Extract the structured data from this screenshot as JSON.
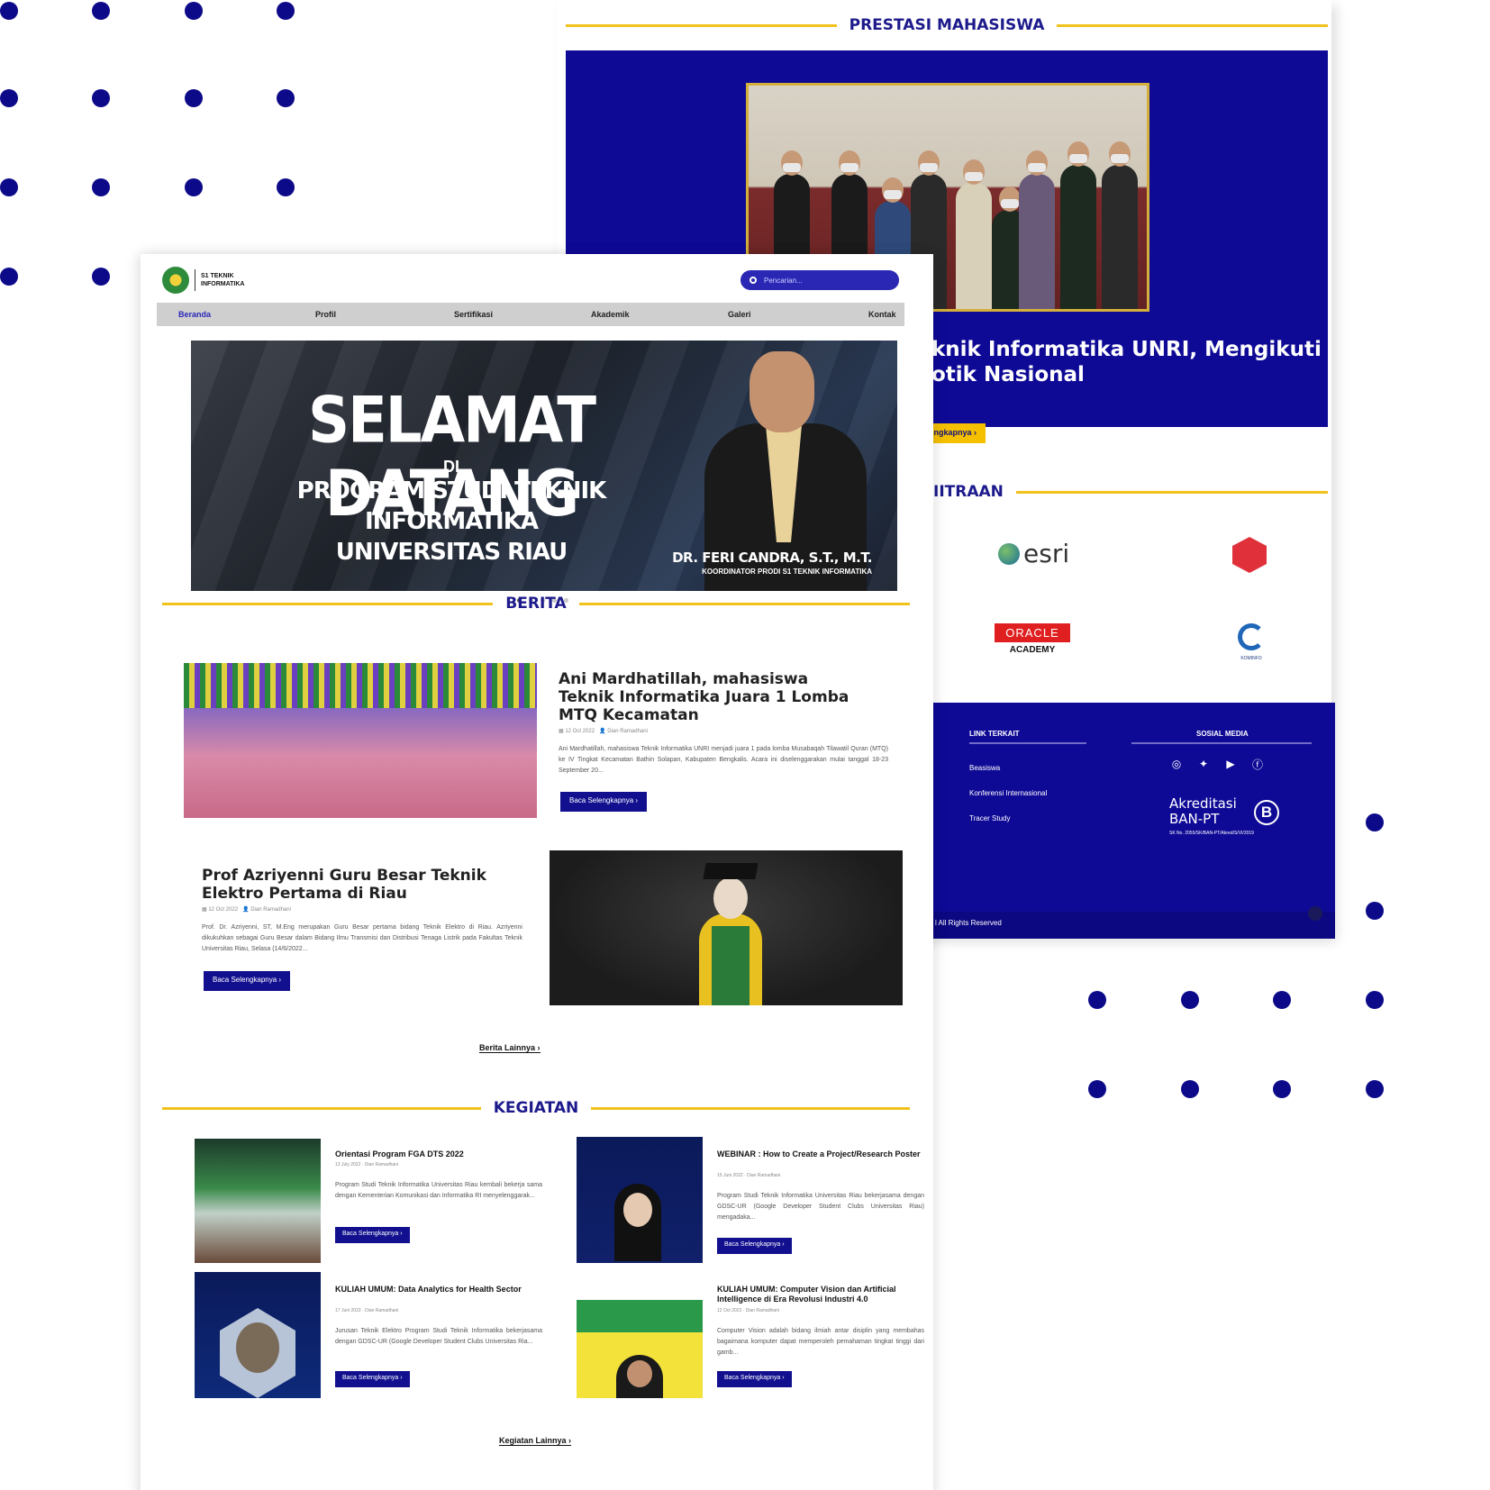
{
  "colors": {
    "navy": "#0f0a96",
    "accent_yellow": "#f2c21c",
    "dot": "#0d0a8a"
  },
  "prestasi": {
    "heading": "PRESTASI MAHASISWA",
    "title": "knik Informatika UNRI, Mengikuti\notik Nasional",
    "button": "elengkapnya ›"
  },
  "mitra": {
    "heading": "IITRAAN",
    "logos": {
      "esri": "esri",
      "oracle_top": "ORACLE",
      "oracle_bottom": "ACADEMY",
      "kominfo": "KOMINFO"
    }
  },
  "footer": {
    "link_heading": "LINK TERKAIT",
    "links": [
      "Beasiswa",
      "Konferensi Internasional",
      "Tracer Study"
    ],
    "social_heading": "SOSIAL MEDIA",
    "social_icons": [
      "instagram-icon",
      "twitter-icon",
      "youtube-icon",
      "facebook-icon"
    ],
    "akreditasi_line1": "Akreditasi",
    "akreditasi_line2": "BAN-PT",
    "akreditasi_grade": "B",
    "akreditasi_sk": "SK No. 2055/SK/BAN-PT/Akred/S/VI/2019",
    "rights": "l All Rights Reserved"
  },
  "site": {
    "logo_line1": "S1 TEKNIK",
    "logo_line2": "INFORMATIKA",
    "search_placeholder": "Pencarian..."
  },
  "nav": [
    "Beranda",
    "Profil",
    "Sertifikasi",
    "Akademik",
    "Galeri",
    "Kontak"
  ],
  "hero": {
    "title": "SELAMAT DATANG",
    "di": "DI",
    "subtitle": "PROGRAM STUDI TEKNIK INFORMATIKA\nUNIVERSITAS RIAU",
    "name": "DR. FERI CANDRA, S.T., M.T.",
    "role": "KOORDINATOR PRODI S1 TEKNIK INFORMATIKA",
    "slides": 5,
    "active_slide": 1
  },
  "berita": {
    "heading": "BERITA",
    "items": [
      {
        "title": "Ani Mardhatillah, mahasiswa Teknik Informatika Juara 1 Lomba MTQ Kecamatan",
        "date": "12 Oct 2022",
        "author": "Dian Ramadhani",
        "excerpt": "Ani Mardhatillah, mahasiswa Teknik Informatika UNRI menjadi juara 1 pada lomba Musabaqah Tilawatil Quran (MTQ) ke IV Tingkat Kecamatan Bathin Solapan, Kabupaten Bengkalis. Acara ini diselenggarakan mulai tanggal 18-23 September 20...",
        "button": "Baca Selengkapnya ›"
      },
      {
        "title": "Prof Azriyenni Guru Besar Teknik Elektro Pertama di Riau",
        "date": "12 Oct 2022",
        "author": "Dian Ramadhani",
        "excerpt": "Prof. Dr. Azriyenni, ST, M.Eng merupakan Guru Besar pertama bidang Teknik Elektro di Riau. Azriyenni dikukuhkan sebagai Guru Besar dalam Bidang Ilmu Transmisi dan Distribusi Tenaga Listrik pada Fakultas Teknik Universitas Riau, Selasa (14/6/2022...",
        "button": "Baca Selengkapnya ›"
      }
    ],
    "more": "Berita Lainnya ›"
  },
  "kegiatan": {
    "heading": "KEGIATAN",
    "items": [
      {
        "title": "Orientasi Program FGA DTS 2022",
        "date": "13 July 2022",
        "author": "Dian Ramadhani",
        "excerpt": "Program Studi Teknik Informatika Universitas Riau kembali bekerja sama dengan Kementerian Komunikasi dan Informatika RI menyelenggarak...",
        "button": "Baca Selengkapnya ›"
      },
      {
        "title": "WEBINAR : How to Create a Project/Research Poster",
        "date": "15 Juni 2022",
        "author": "Dian Ramadhani",
        "excerpt": "Program Studi Teknik Informatika Universitas Riau bekerjasama dengan GDSC-UR (Google Developer Student Clubs Universitas Riau) mengadaka...",
        "button": "Baca Selengkapnya ›"
      },
      {
        "title": "KULIAH UMUM: Data Analytics for Health Sector",
        "date": "17 Juni 2022",
        "author": "Dian Ramadhani",
        "excerpt": "Jurusan Teknik Elektro Program Studi Teknik Informatika bekerjasama dengan GDSC-UR (Google Developer Student Clubs Universitas Ria...",
        "button": "Baca Selengkapnya ›"
      },
      {
        "title": "KULIAH UMUM: Computer Vision dan Artificial Intelligence di Era Revolusi Industri 4.0",
        "date": "12 Oct 2022",
        "author": "Dian Ramadhani",
        "excerpt": "Computer Vision adalah bidang ilmiah antar disiplin yang membahas bagaimana komputer dapat memperoleh pemahaman tingkat tinggi dari gamb...",
        "button": "Baca Selengkapnya ›"
      }
    ],
    "more": "Kegiatan Lainnya ›"
  }
}
